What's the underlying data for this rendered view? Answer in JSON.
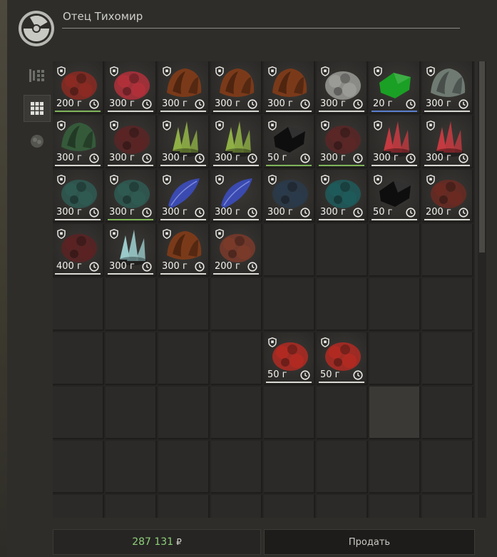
{
  "trader": {
    "name": "Отец Тихомир",
    "icon": "radiation-icon"
  },
  "tabs": [
    {
      "icon": "list-sort-icon",
      "active": false
    },
    {
      "icon": "grid-icon",
      "active": true
    },
    {
      "icon": "artifact-icon",
      "active": false
    }
  ],
  "grid": {
    "columns": 8,
    "rows": 9
  },
  "items": [
    {
      "price": "200 г",
      "color": "#8a2a22",
      "kind": "rock",
      "underline": "green"
    },
    {
      "price": "300 г",
      "color": "#b0303a",
      "kind": "rock",
      "underline": "white"
    },
    {
      "price": "300 г",
      "color": "#7a3a1a",
      "kind": "shell",
      "underline": "white"
    },
    {
      "price": "300 г",
      "color": "#7a3a1a",
      "kind": "shell",
      "underline": "white"
    },
    {
      "price": "300 г",
      "color": "#7a3a1a",
      "kind": "shell",
      "underline": "white"
    },
    {
      "price": "300 г",
      "color": "#9a9a96",
      "kind": "rock",
      "underline": "white"
    },
    {
      "price": "20 г",
      "color": "#1aa024",
      "kind": "gem",
      "underline": "blue"
    },
    {
      "price": "300 г",
      "color": "#6f7a73",
      "kind": "shell",
      "underline": "white"
    },
    {
      "price": "300 г",
      "color": "#355a3a",
      "kind": "shell",
      "underline": "white"
    },
    {
      "price": "300 г",
      "color": "#5a2424",
      "kind": "rock",
      "underline": "white"
    },
    {
      "price": "300 г",
      "color": "#8fb045",
      "kind": "crystal",
      "underline": "white"
    },
    {
      "price": "300 г",
      "color": "#8fb045",
      "kind": "crystal",
      "underline": "white"
    },
    {
      "price": "50 г",
      "color": "#0e0e0e",
      "kind": "gem",
      "underline": "green"
    },
    {
      "price": "300 г",
      "color": "#5a2626",
      "kind": "rock",
      "underline": "green"
    },
    {
      "price": "300 г",
      "color": "#c43a40",
      "kind": "crystal",
      "underline": "white"
    },
    {
      "price": "300 г",
      "color": "#c43a40",
      "kind": "crystal",
      "underline": "white"
    },
    {
      "price": "300 г",
      "color": "#2e5a52",
      "kind": "rock",
      "underline": "white"
    },
    {
      "price": "300 г",
      "color": "#2e5a52",
      "kind": "rock",
      "underline": "green"
    },
    {
      "price": "300 г",
      "color": "#3a4ab0",
      "kind": "feather",
      "underline": "white"
    },
    {
      "price": "300 г",
      "color": "#3a4ab0",
      "kind": "feather",
      "underline": "white"
    },
    {
      "price": "300 г",
      "color": "#2a3a4a",
      "kind": "rock",
      "underline": "white"
    },
    {
      "price": "300 г",
      "color": "#1e5a5a",
      "kind": "rock",
      "underline": "white"
    },
    {
      "price": "50 г",
      "color": "#0e0e0e",
      "kind": "gem",
      "underline": "white"
    },
    {
      "price": "200 г",
      "color": "#6a2a22",
      "kind": "rock",
      "underline": "white"
    },
    {
      "price": "400 г",
      "color": "#5a2222",
      "kind": "rock",
      "underline": "white"
    },
    {
      "price": "300 г",
      "color": "#9acaca",
      "kind": "crystal",
      "underline": "white"
    },
    {
      "price": "300 г",
      "color": "#7a3a1a",
      "kind": "shell",
      "underline": "white"
    },
    {
      "price": "200 г",
      "color": "#7a3a2a",
      "kind": "rock",
      "underline": "white"
    },
    {
      "price": "50 г",
      "color": "#b02a22",
      "kind": "rock",
      "underline": "white"
    },
    {
      "price": "50 г",
      "color": "#b02a22",
      "kind": "rock",
      "underline": "white"
    }
  ],
  "money": {
    "amount": "287 131",
    "currency": "₽",
    "color": "#8ecf7a"
  },
  "sell_button": {
    "label": "Продать"
  }
}
